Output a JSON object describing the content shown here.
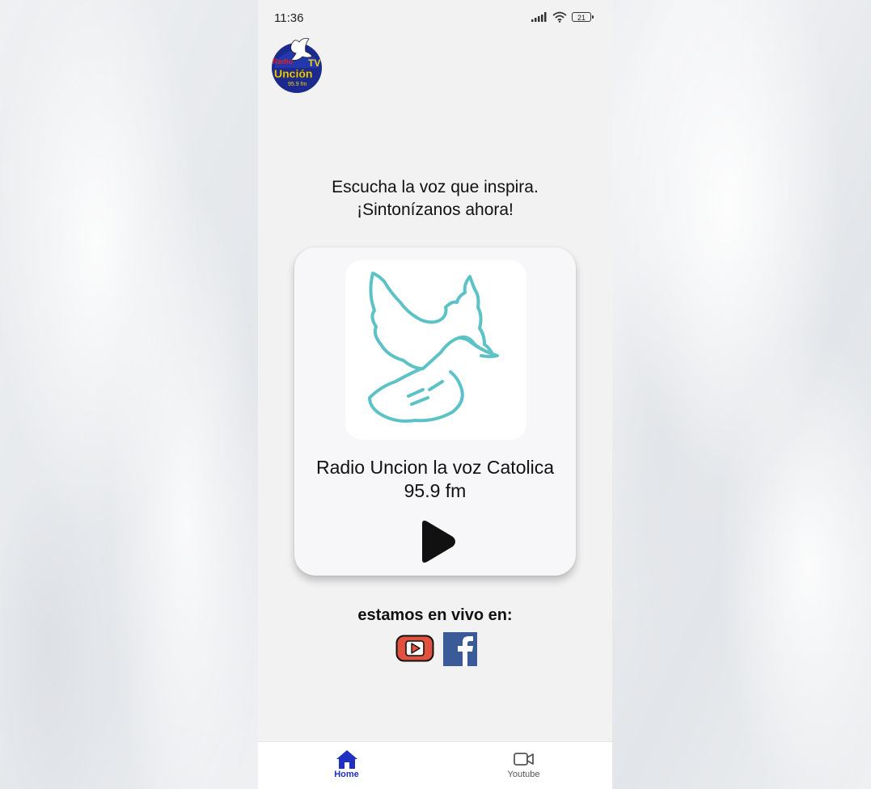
{
  "status_bar": {
    "time": "11:36",
    "battery": "21",
    "icons": [
      "signal-icon",
      "wifi-icon",
      "battery-icon"
    ]
  },
  "logo": {
    "icon": "radio-uncion-logo",
    "text_top_left": "Radio",
    "text_top_right": "TV",
    "text_main": "Unción",
    "text_freq": "95.9 fm"
  },
  "headline": {
    "line1": "Escucha la voz que inspira.",
    "line2": "¡Sintonízanos ahora!"
  },
  "player": {
    "artwork_icon": "dove-icon",
    "station_name": "Radio Uncion la voz Catolica",
    "frequency": "95.9 fm",
    "play_icon": "play-icon"
  },
  "live": {
    "label": "estamos en vivo en:",
    "links": [
      {
        "icon": "youtube-icon"
      },
      {
        "icon": "facebook-icon"
      }
    ]
  },
  "bottom_nav": {
    "items": [
      {
        "label": "Home",
        "icon": "home-icon",
        "active": true
      },
      {
        "label": "Youtube",
        "icon": "video-camera-icon",
        "active": false
      }
    ]
  },
  "colors": {
    "accent": "#1f2fbf",
    "dove": "#5cc2c6",
    "youtube_red": "#e0523f",
    "facebook_blue": "#3a5b98"
  }
}
